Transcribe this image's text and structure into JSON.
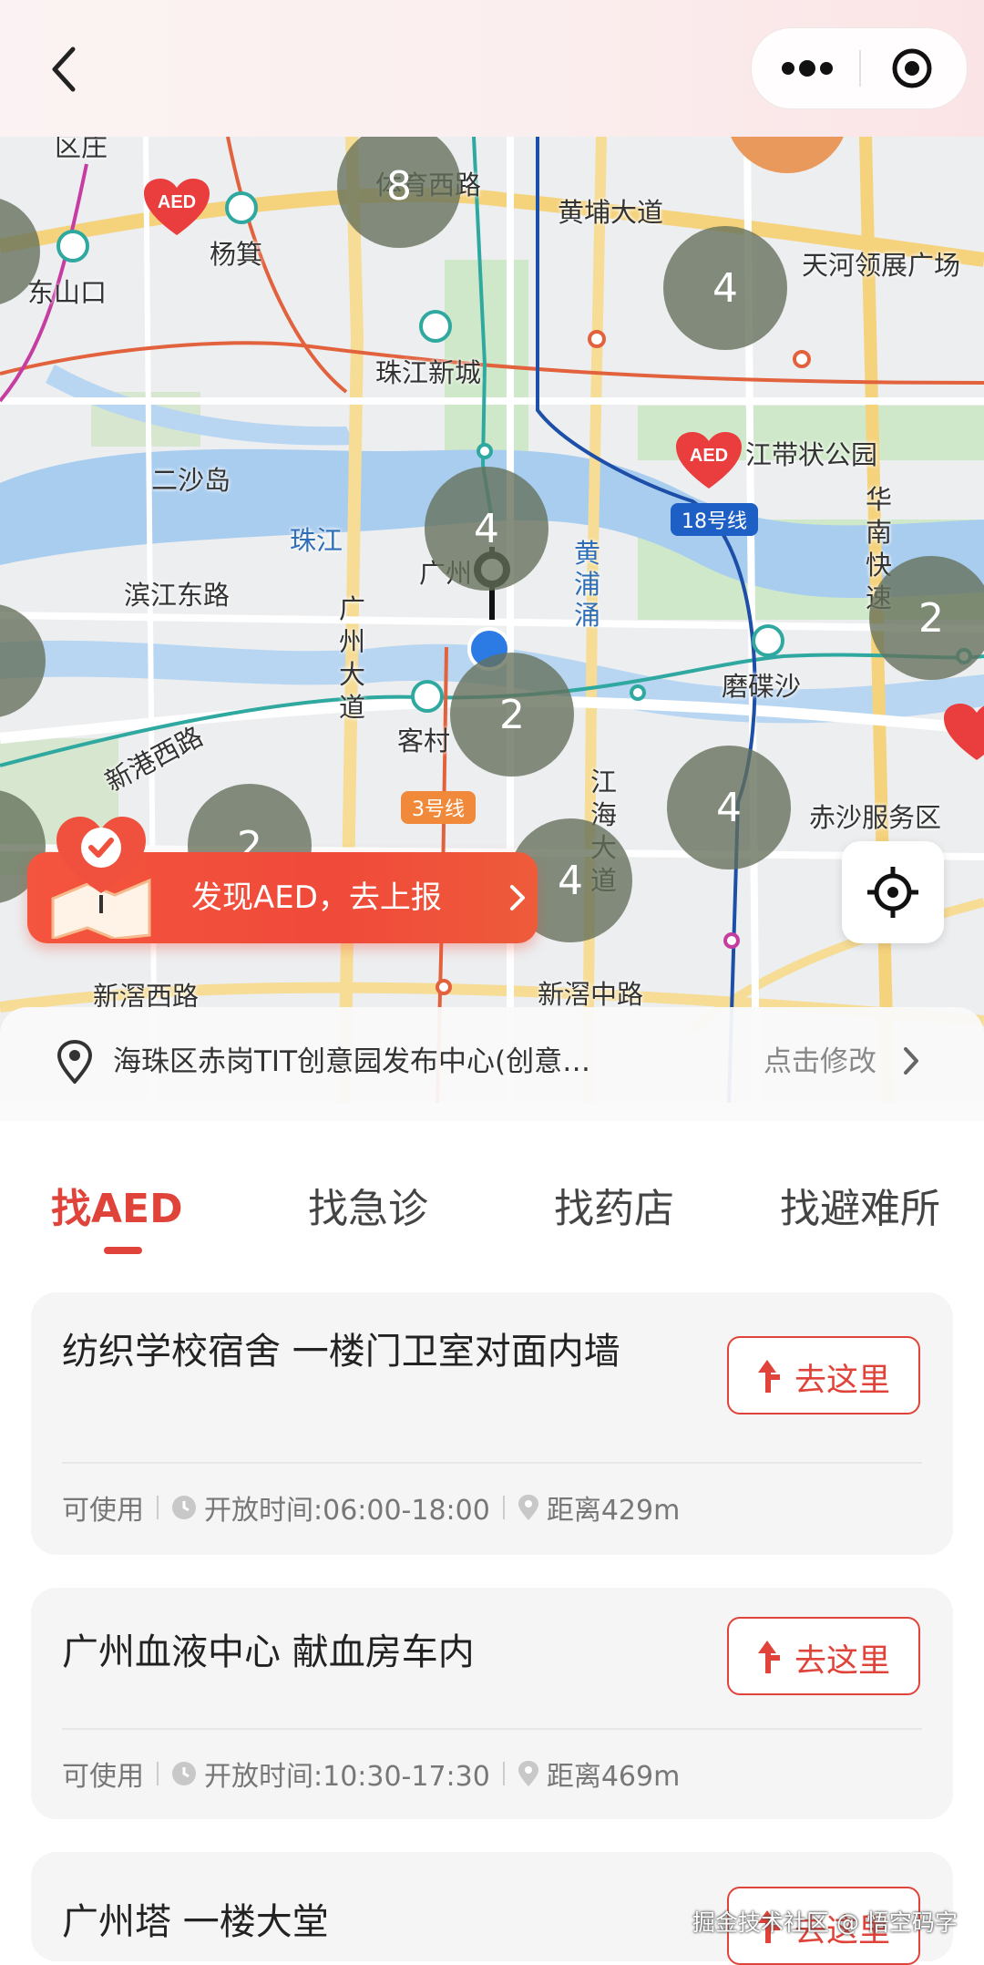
{
  "navbar": {
    "back_icon": "chevron-left-icon",
    "more_icon": "more-dots-icon",
    "close_icon": "target-close-icon"
  },
  "map": {
    "labels": {
      "district_top": "区庄",
      "road_tiyu": "体育西路",
      "road_huangpu": "黄埔大道",
      "yangji": "杨箕",
      "dongshankou": "东山口",
      "tianhe_plaza": "天河领展广场",
      "zhujiang_newtown": "珠江新城",
      "ershadao": "二沙岛",
      "belt_park": "江带状公园",
      "zhujiang": "珠江",
      "huangpuchong": "黄浦涌",
      "huananexpress": "华南快速",
      "binjiang_east": "滨江东路",
      "guangzhou_ave": "广州大道",
      "mudisha": "磨碟沙",
      "kecun": "客村",
      "xingang_west": "新港西路",
      "jianghai_ave": "江海大道",
      "chisha_service": "赤沙服务区",
      "xinjiao_west": "新滘西路",
      "xinjiao_mid": "新滘中路",
      "guangzhouta_partial": "广州"
    },
    "line_badges": {
      "line18": "18号线",
      "line3": "3号线"
    },
    "clusters": [
      "8",
      "4",
      "4",
      "2",
      "2",
      "4",
      "2",
      "4"
    ],
    "report_banner": "发现AED，去上报",
    "locate_icon": "crosshair-locate-icon"
  },
  "address": {
    "text": "海珠区赤岗TIT创意园发布中心(创意…",
    "edit": "点击修改"
  },
  "tabs": [
    {
      "label": "找AED"
    },
    {
      "label": "找急诊"
    },
    {
      "label": "找药店"
    },
    {
      "label": "找避难所"
    }
  ],
  "list": [
    {
      "title": "纺织学校宿舍 一楼门卫室对面内墙",
      "status": "可使用",
      "hours": "开放时间:06:00-18:00",
      "distance": "距离429m",
      "button": "去这里"
    },
    {
      "title": "广州血液中心 献血房车内",
      "status": "可使用",
      "hours": "开放时间:10:30-17:30",
      "distance": "距离469m",
      "button": "去这里"
    },
    {
      "title": "广州塔 一楼大堂",
      "button": "去这里"
    }
  ],
  "watermark": "掘金技术社区 @ 悟空码字",
  "colors": {
    "accent": "#e04339",
    "cluster": "#64705a"
  }
}
